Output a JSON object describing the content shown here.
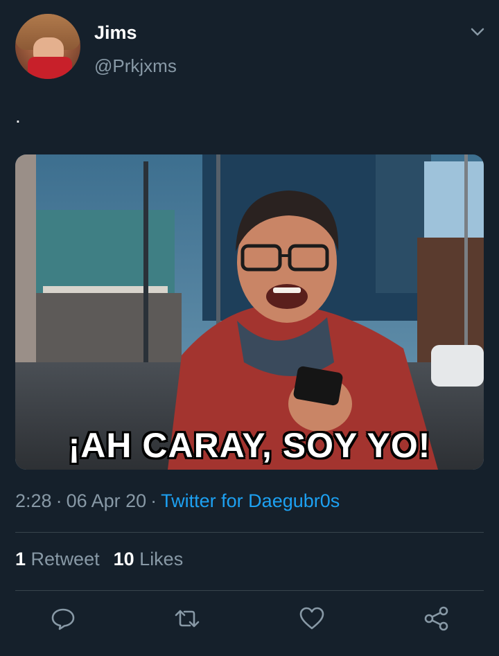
{
  "user": {
    "display_name": "Jims",
    "handle": "@Prkjxms"
  },
  "tweet": {
    "text": ".",
    "media": {
      "caption": "¡AH CARAY, SOY YO!"
    },
    "time": "2:28",
    "date": "06 Apr 20",
    "separator": "·",
    "source": "Twitter for Daegubr0s"
  },
  "stats": {
    "retweets_count": "1",
    "retweets_label": "Retweet",
    "likes_count": "10",
    "likes_label": "Likes"
  },
  "icons": {
    "more": "chevron-down-icon",
    "reply": "reply-icon",
    "retweet": "retweet-icon",
    "like": "heart-icon",
    "share": "share-icon"
  },
  "colors": {
    "background": "#15202b",
    "secondary_text": "#8899a6",
    "link": "#1da1f2",
    "divider": "#38444d"
  }
}
